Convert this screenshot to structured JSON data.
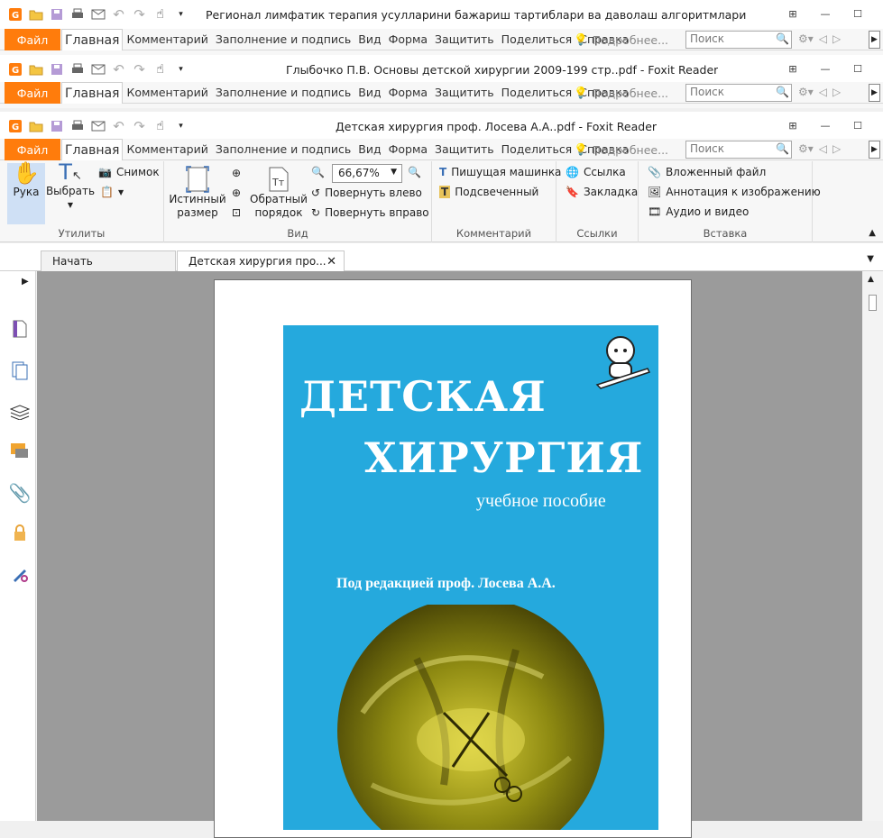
{
  "windows": [
    {
      "title": "Регионал лимфатик терапия усулларини бажариш тартиблари ва даволаш алгоритмлари. Хакимов В. ..."
    },
    {
      "title": "Глыбочко П.В. Основы детской хирургии 2009-199 стр..pdf - Foxit Reader"
    },
    {
      "title": "Детская хирургия проф. Лосева А.А..pdf - Foxit Reader"
    }
  ],
  "menu": {
    "file": "Файл",
    "items": [
      "Главная",
      "Комментарий",
      "Заполнение и подпись",
      "Вид",
      "Форма",
      "Защитить",
      "Поделиться",
      "Справка"
    ],
    "tell_me": "Подробнее...",
    "search_placeholder": "Поиск"
  },
  "ribbon": {
    "utilities": {
      "label": "Утилиты",
      "hand": "Рука",
      "select": "Выбрать",
      "snapshot": "Снимок"
    },
    "view": {
      "label": "Вид",
      "actual_size_1": "Истинный",
      "actual_size_2": "размер",
      "reverse_1": "Обратный",
      "reverse_2": "порядок",
      "zoom": "66,67%",
      "rotate_left": "Повернуть влево",
      "rotate_right": "Повернуть вправо"
    },
    "comment": {
      "label": "Комментарий",
      "typewriter": "Пишущая машинка",
      "highlight": "Подсвеченный"
    },
    "links": {
      "label": "Ссылки",
      "link": "Ссылка",
      "bookmark": "Закладка"
    },
    "insert": {
      "label": "Вставка",
      "attachment": "Вложенный файл",
      "image_annotation": "Аннотация к изображению",
      "audio_video": "Аудио и видео"
    }
  },
  "tabs": [
    {
      "label": "Начать"
    },
    {
      "label": "Детская хирургия про..."
    }
  ],
  "document": {
    "title_line1": "ДЕТСКАЯ",
    "title_line2": "ХИРУРГИЯ",
    "subtitle": "учебное пособие",
    "editor": "Под редакцией проф. Лосева А.А."
  },
  "colors": {
    "accent": "#ff7c0c",
    "cover": "#25a9dd",
    "canvas": "#9b9b9b"
  }
}
